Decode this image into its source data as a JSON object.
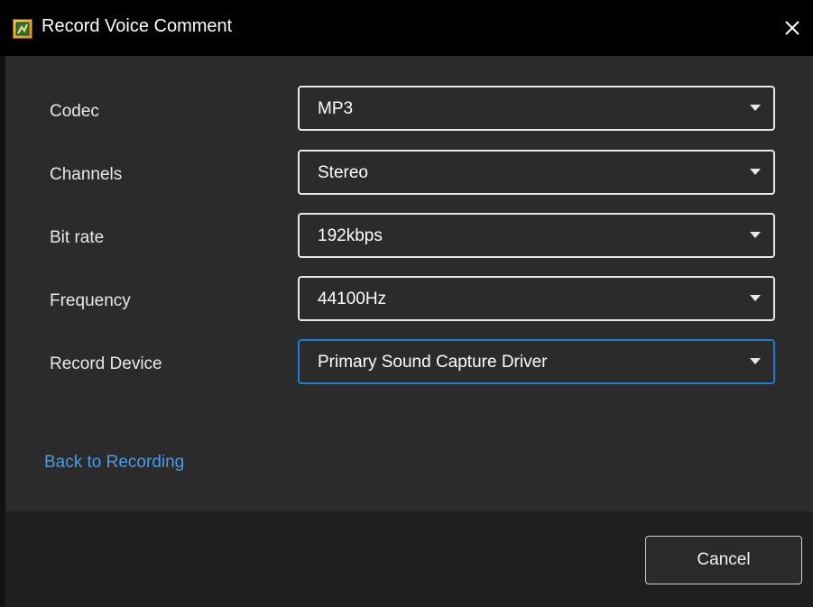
{
  "window": {
    "title": "Record Voice Comment",
    "app_icon": "app-logo-icon",
    "close_icon": "close-icon"
  },
  "form": {
    "rows": [
      {
        "label": "Codec",
        "value": "MP3"
      },
      {
        "label": "Channels",
        "value": "Stereo"
      },
      {
        "label": "Bit rate",
        "value": "192kbps"
      },
      {
        "label": "Frequency",
        "value": "44100Hz"
      },
      {
        "label": "Record Device",
        "value": "Primary Sound Capture Driver",
        "focused": true
      }
    ],
    "back_link": "Back to Recording"
  },
  "footer": {
    "cancel_label": "Cancel"
  },
  "colors": {
    "background": "#2b2b2b",
    "titlebar": "#000000",
    "footer": "#1f1f1f",
    "link": "#4a9be8",
    "focus_border": "#1f7ad8"
  }
}
